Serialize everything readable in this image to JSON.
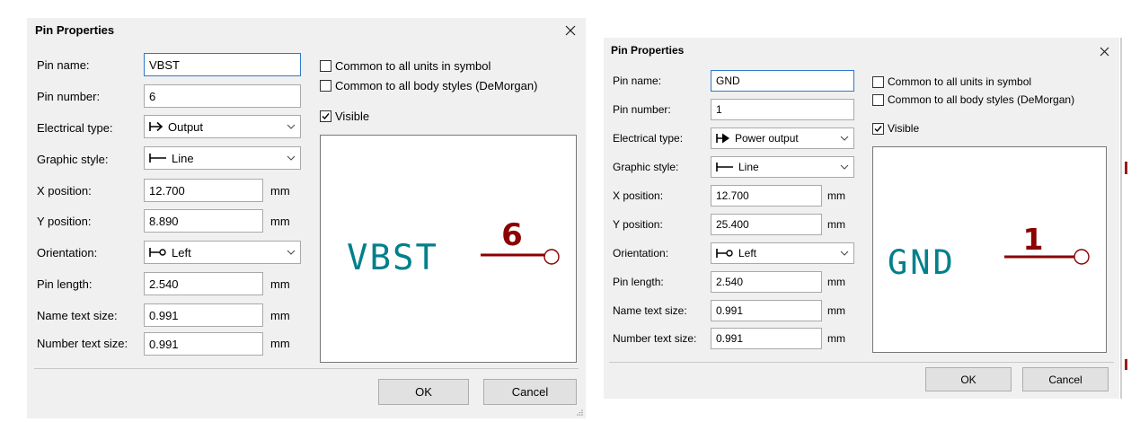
{
  "dialogs": [
    {
      "title": "Pin Properties",
      "fields": {
        "pin_name": {
          "label": "Pin name:",
          "value": "VBST"
        },
        "pin_number": {
          "label": "Pin number:",
          "value": "6"
        },
        "electrical_type": {
          "label": "Electrical type:",
          "value": "Output",
          "icon": "output-arrow-icon"
        },
        "graphic_style": {
          "label": "Graphic style:",
          "value": "Line",
          "icon": "line-style-icon"
        },
        "x_position": {
          "label": "X position:",
          "value": "12.700",
          "unit": "mm"
        },
        "y_position": {
          "label": "Y position:",
          "value": "8.890",
          "unit": "mm"
        },
        "orientation": {
          "label": "Orientation:",
          "value": "Left",
          "icon": "orientation-left-icon"
        },
        "pin_length": {
          "label": "Pin length:",
          "value": "2.540",
          "unit": "mm"
        },
        "name_text_size": {
          "label": "Name text size:",
          "value": "0.991",
          "unit": "mm"
        },
        "number_text_size": {
          "label": "Number text size:",
          "value": "0.991",
          "unit": "mm"
        }
      },
      "checkboxes": {
        "common_units": {
          "label": "Common to all units in symbol",
          "checked": false
        },
        "common_body": {
          "label": "Common to all body styles (DeMorgan)",
          "checked": false
        },
        "visible": {
          "label": "Visible",
          "checked": true
        }
      },
      "preview": {
        "pin_name_text": "VBST",
        "pin_number_text": "6"
      },
      "buttons": {
        "ok": "OK",
        "cancel": "Cancel"
      }
    },
    {
      "title": "Pin Properties",
      "fields": {
        "pin_name": {
          "label": "Pin name:",
          "value": "GND"
        },
        "pin_number": {
          "label": "Pin number:",
          "value": "1"
        },
        "electrical_type": {
          "label": "Electrical type:",
          "value": "Power output",
          "icon": "power-output-arrow-icon"
        },
        "graphic_style": {
          "label": "Graphic style:",
          "value": "Line",
          "icon": "line-style-icon"
        },
        "x_position": {
          "label": "X position:",
          "value": "12.700",
          "unit": "mm"
        },
        "y_position": {
          "label": "Y position:",
          "value": "25.400",
          "unit": "mm"
        },
        "orientation": {
          "label": "Orientation:",
          "value": "Left",
          "icon": "orientation-left-icon"
        },
        "pin_length": {
          "label": "Pin length:",
          "value": "2.540",
          "unit": "mm"
        },
        "name_text_size": {
          "label": "Name text size:",
          "value": "0.991",
          "unit": "mm"
        },
        "number_text_size": {
          "label": "Number text size:",
          "value": "0.991",
          "unit": "mm"
        }
      },
      "checkboxes": {
        "common_units": {
          "label": "Common to all units in symbol",
          "checked": false
        },
        "common_body": {
          "label": "Common to all body styles (DeMorgan)",
          "checked": false
        },
        "visible": {
          "label": "Visible",
          "checked": true
        }
      },
      "preview": {
        "pin_name_text": "GND",
        "pin_number_text": "1"
      },
      "buttons": {
        "ok": "OK",
        "cancel": "Cancel"
      }
    }
  ],
  "colors": {
    "pin_name_text": "#00808a",
    "pin_number_text": "#8b0000",
    "pin_line": "#8b0000",
    "dialog_bg": "#f0f0f0",
    "focus_border": "#2f79c8"
  }
}
